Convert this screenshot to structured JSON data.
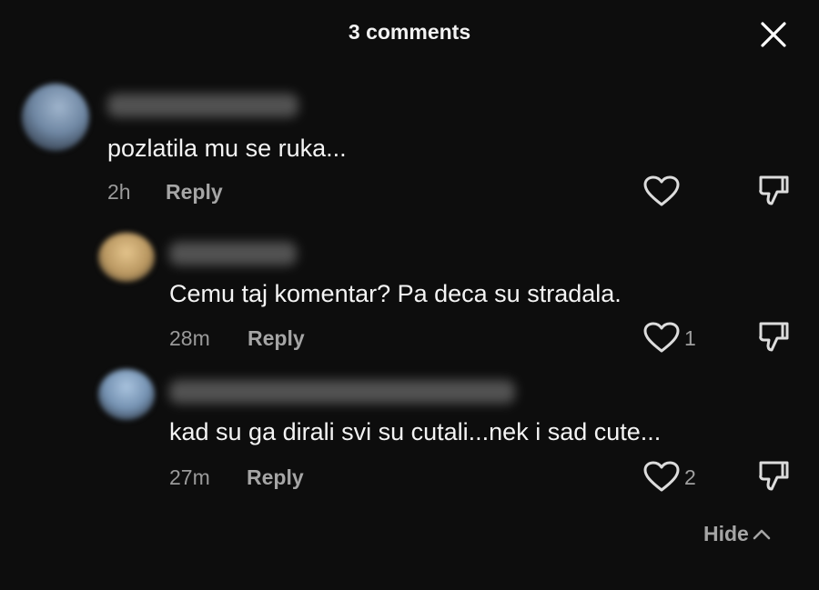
{
  "header": {
    "title": "3 comments"
  },
  "icons": {
    "close": "close-icon",
    "like": "heart-icon",
    "dislike": "thumbs-down-icon",
    "hide": "chevron-up-icon"
  },
  "comments": [
    {
      "text": "pozlatila mu se ruka...",
      "time": "2h",
      "reply_label": "Reply",
      "likes": ""
    },
    {
      "text": "Cemu taj komentar? Pa deca su stradala.",
      "time": "28m",
      "reply_label": "Reply",
      "likes": "1"
    },
    {
      "text": "kad su ga dirali svi su cutali...nek i sad cute...",
      "time": "27m",
      "reply_label": "Reply",
      "likes": "2"
    }
  ],
  "footer": {
    "hide_label": "Hide"
  }
}
